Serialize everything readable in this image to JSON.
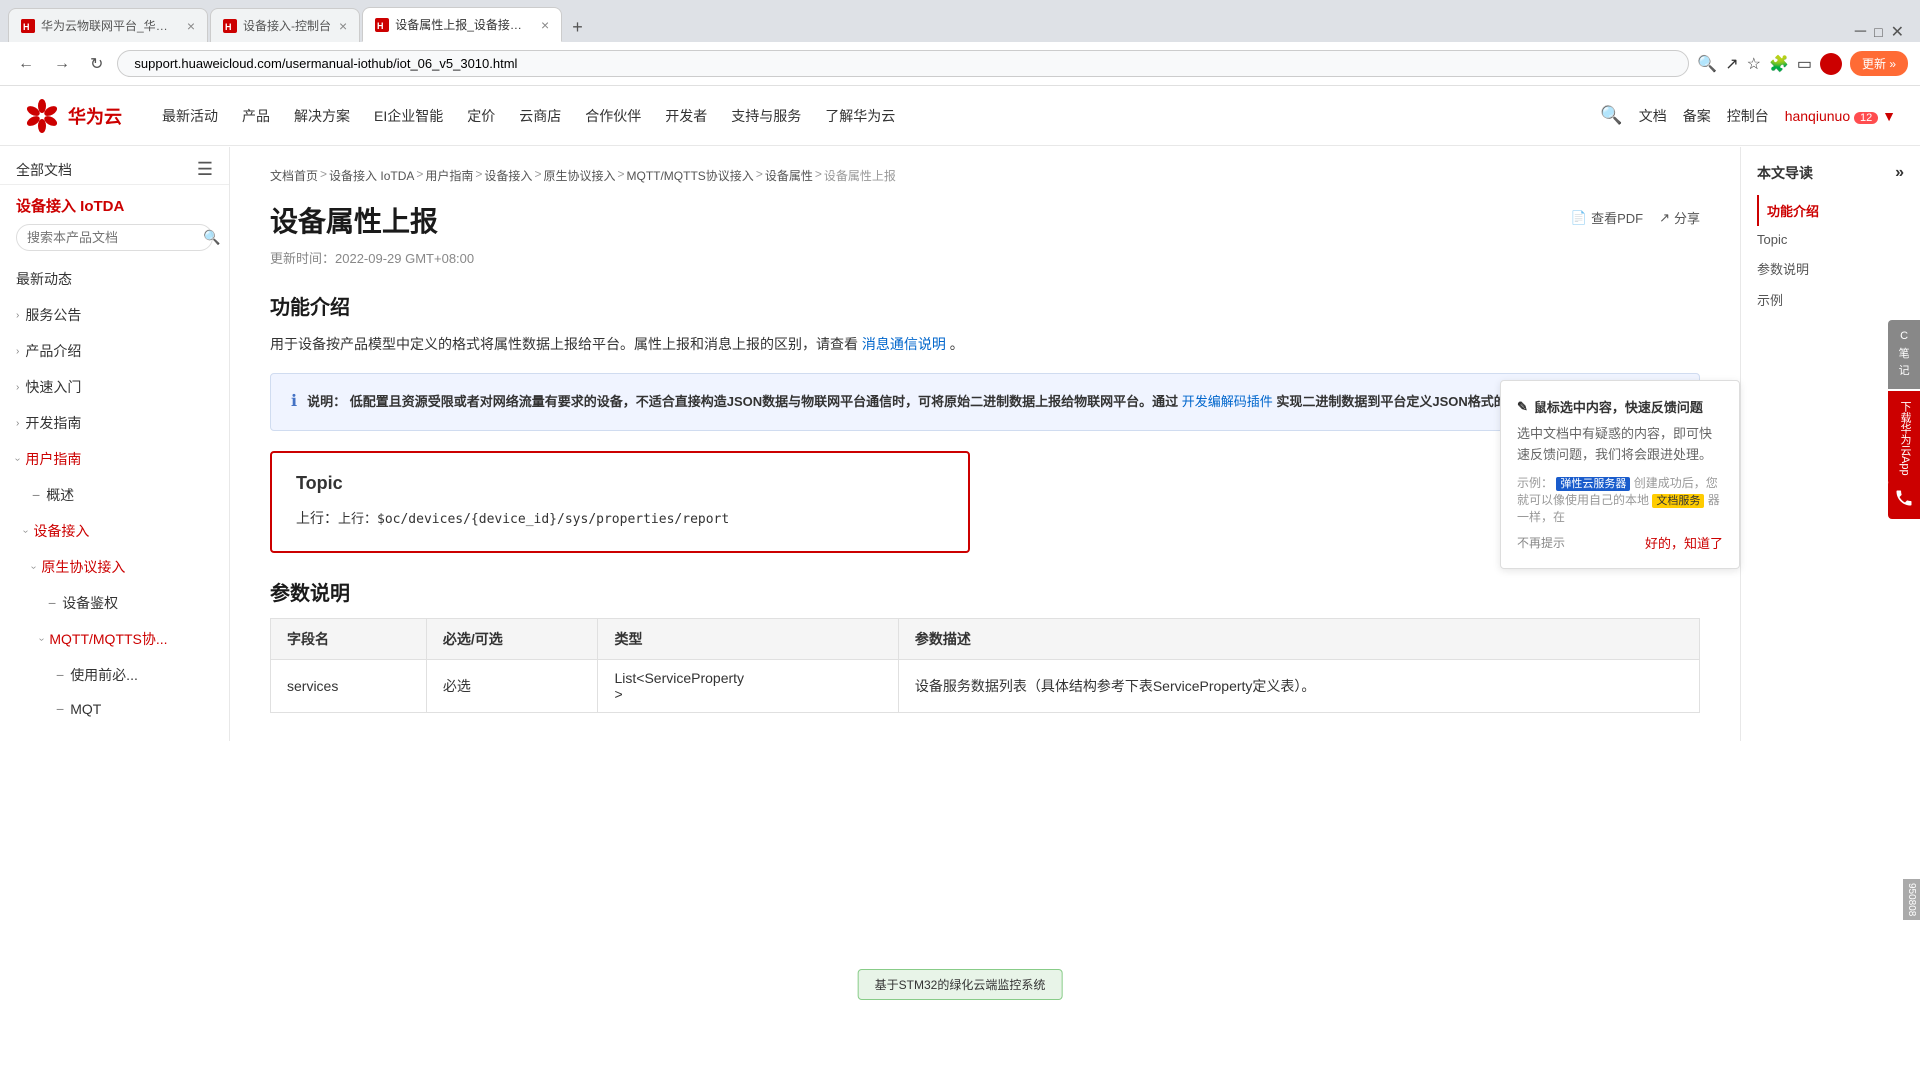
{
  "browser": {
    "tabs": [
      {
        "id": "tab1",
        "title": "华为云物联网平台_华为云IoT平...",
        "active": false,
        "favicon_color": "#cc0000"
      },
      {
        "id": "tab2",
        "title": "设备接入-控制台",
        "active": false,
        "favicon_color": "#cc0000"
      },
      {
        "id": "tab3",
        "title": "设备属性上报_设备接入 IoTDA ...",
        "active": true,
        "favicon_color": "#cc0000"
      }
    ],
    "address": "support.huaweicloud.com/usermanual-iothub/iot_06_v5_3010.html",
    "update_btn": "更新 »"
  },
  "topnav": {
    "logo_text": "华为云",
    "links": [
      "最新活动",
      "产品",
      "解决方案",
      "EI企业智能",
      "定价",
      "云商店",
      "合作伙伴",
      "开发者",
      "支持与服务",
      "了解华为云"
    ],
    "right": {
      "doc": "文档",
      "backup": "备案",
      "console": "控制台",
      "user": "hanqiunuo",
      "badge": "12"
    }
  },
  "left_sidebar": {
    "all_docs": "全部文档",
    "product": "设备接入 IoTDA",
    "search_placeholder": "搜索本产品文档",
    "menu": [
      {
        "label": "最新动态",
        "level": 0,
        "has_arrow": false,
        "active": false
      },
      {
        "label": "服务公告",
        "level": 0,
        "has_arrow": true,
        "active": false
      },
      {
        "label": "产品介绍",
        "level": 0,
        "has_arrow": true,
        "active": false
      },
      {
        "label": "快速入门",
        "level": 0,
        "has_arrow": true,
        "active": false
      },
      {
        "label": "开发指南",
        "level": 0,
        "has_arrow": true,
        "active": false
      },
      {
        "label": "用户指南",
        "level": 0,
        "has_arrow": true,
        "active": true
      },
      {
        "label": "概述",
        "level": 1,
        "has_arrow": false,
        "active": false,
        "is_dash": true
      },
      {
        "label": "设备接入",
        "level": 1,
        "has_arrow": true,
        "active": true
      },
      {
        "label": "原生协议接入",
        "level": 2,
        "has_arrow": true,
        "active": true
      },
      {
        "label": "设备鉴权",
        "level": 3,
        "has_arrow": false,
        "active": false,
        "is_dash": true
      },
      {
        "label": "MQTT/MQTTS协...",
        "level": 3,
        "has_arrow": true,
        "active": true
      },
      {
        "label": "使用前必...",
        "level": 4,
        "has_arrow": false,
        "active": false,
        "is_dash": true
      },
      {
        "label": "MQT",
        "level": 4,
        "has_arrow": false,
        "active": false,
        "is_dash": true
      }
    ]
  },
  "breadcrumb": {
    "items": [
      "文档首页",
      "设备接入 IoTDA",
      "用户指南",
      "设备接入",
      "原生协议接入",
      "MQTT/MQTTS协议接入",
      "设备属性",
      "设备属性上报"
    ]
  },
  "main": {
    "title": "设备属性上报",
    "update_time": "更新时间：2022-09-29 GMT+08:00",
    "pdf_btn": "查看PDF",
    "share_btn": "分享",
    "section_intro_title": "功能介绍",
    "intro_text": "用于设备按产品模型中定义的格式将属性数据上报给平台。属性上报和消息上报的区别，请查看",
    "intro_link": "消息通信说明",
    "intro_suffix": "。",
    "notice": {
      "label": "说明：",
      "text1": "低配置且资源受限或者对网络流量有要求的设备，不适合直接构造JSON数据与物联网平台通信时，可将原始二进制数据上报给物联网平台。通过",
      "link": "开发编解码插件",
      "text2": "实现二进制数据到平台定义JSON格式的转换。"
    },
    "topic_section_title": "Topic",
    "topic_content": "上行：$oc/devices/{device_id}/sys/properties/report",
    "params_section_title": "参数说明",
    "params_table": {
      "headers": [
        "字段名",
        "必选/可选",
        "类型",
        "参数描述"
      ],
      "rows": [
        {
          "field": "services",
          "required": "必选",
          "type": "List<ServiceProperty\n>",
          "desc": "设备服务数据列表（具体结构参考下表ServiceProperty定义表）。"
        }
      ]
    }
  },
  "right_toc": {
    "header": "本文导读",
    "items": [
      {
        "label": "功能介绍",
        "active": true
      },
      {
        "label": "Topic",
        "active": false
      },
      {
        "label": "参数说明",
        "active": false
      },
      {
        "label": "示例",
        "active": false
      }
    ]
  },
  "feedback": {
    "title_icon": "✎",
    "title": "鼠标选中内容，快速反馈问题",
    "desc": "选中文档中有疑惑的内容，即可快速反馈问题，我们将会跟进处理。",
    "example_label": "示例：",
    "highlight_text": "弹性云服务器",
    "example_text": "创建成功后，您就可以像使用自己的本地",
    "highlight2": "文档服务",
    "example_text2": "器一样，在",
    "no_remind": "不再提示",
    "ok": "好的，知道了"
  },
  "float_buttons": [
    {
      "label": "C\n笔\n记",
      "color": "#888"
    },
    {
      "label": "下载华为云App",
      "color": "#cc0000",
      "vertical": true
    }
  ],
  "stm32_banner": "基于STM32的绿化云端监控系统",
  "side_number": "950808"
}
